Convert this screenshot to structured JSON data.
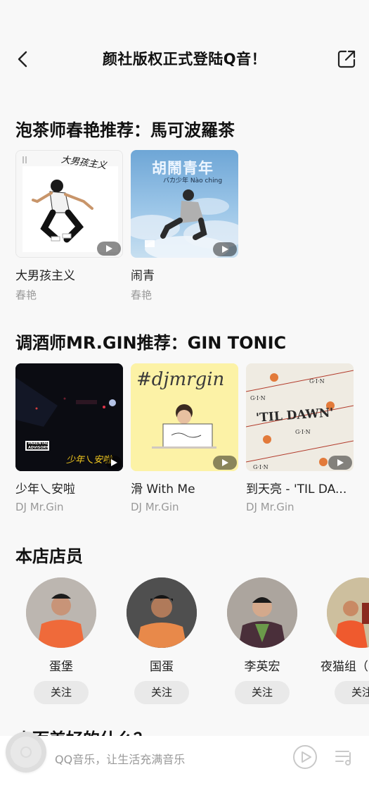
{
  "header": {
    "title": "颜社版权正式登陆Q音！"
  },
  "sections": [
    {
      "title": "泡茶师春艳推荐：馬可波羅茶",
      "items": [
        {
          "name": "大男孩主义",
          "artist": "春艳",
          "cover_text": "大男孩主义"
        },
        {
          "name": "闹青",
          "artist": "春艳",
          "cover_text": "胡鬧青年",
          "cover_subtext": "バカ少年  Nào ching"
        }
      ]
    },
    {
      "title": "调酒师MR.GIN推荐：GIN TONIC",
      "items": [
        {
          "name": "少年乀安啦",
          "artist": "DJ Mr.Gin",
          "cover_text": "少年乀安啦"
        },
        {
          "name": "滑 With Me",
          "artist": "DJ Mr.Gin",
          "cover_text": "#djmrgin"
        },
        {
          "name": "到天亮 - 'TIL DA...",
          "artist": "DJ Mr.Gin",
          "cover_text": "'TIL DAWN'"
        }
      ]
    }
  ],
  "staff_section": {
    "title": "本店店员",
    "follow_label": "关注",
    "members": [
      {
        "name": "蛋堡"
      },
      {
        "name": "国蛋"
      },
      {
        "name": "李英宏"
      },
      {
        "name": "夜猫组（"
      }
    ]
  },
  "peek_section": {
    "title": "小而美好的什么？"
  },
  "player": {
    "text": "QQ音乐，让生活充满音乐"
  },
  "colors": {
    "background": "#f8f8f8",
    "play_pill": "#00000073",
    "follow_button": "#e9e9e9",
    "muted_text": "#999999"
  }
}
